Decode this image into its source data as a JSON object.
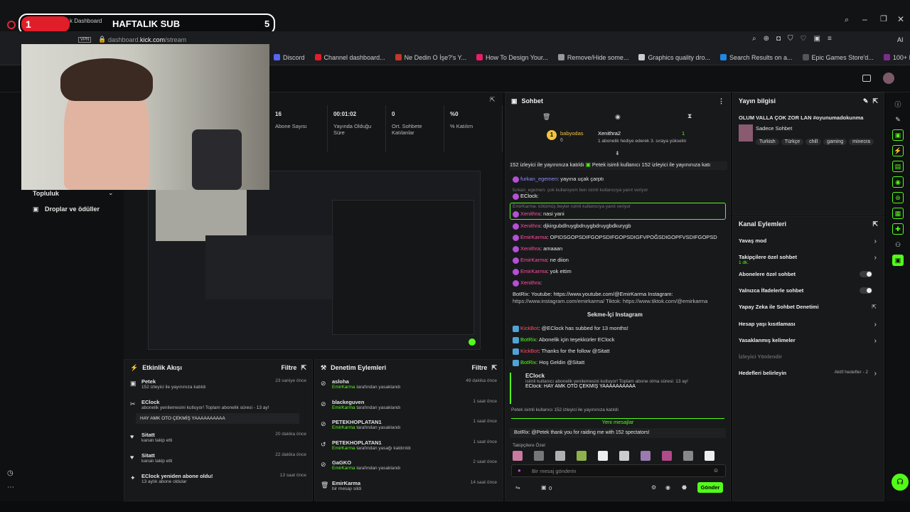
{
  "overlay": {
    "count_left": "1",
    "title": "HAFTALIK SUB",
    "count_right": "5",
    "tab_label": "k Dashboard"
  },
  "browser": {
    "url_prefix": "dashboard.",
    "url_domain": "kick.com",
    "url_path": "/stream",
    "vpn": "VPN",
    "ai": "AI",
    "bookmarks": [
      "Discord",
      "Channel dashboard...",
      "Ne Dedin O İşe?'s Y...",
      "How To Design Your...",
      "Remove/Hide some...",
      "Graphics quality dro...",
      "Search Results on a...",
      "Epic Games Store'd...",
      "100+ Free motion g..."
    ]
  },
  "stats": [
    {
      "value": "16",
      "label": "Abone Sayısı"
    },
    {
      "value": "00:01:02",
      "label": "Yayında Olduğu Süre"
    },
    {
      "value": "0",
      "label": "Ort. Sohbete Katılanlar"
    },
    {
      "value": "%0",
      "label": "% Katılım"
    }
  ],
  "leftnav": {
    "community": "Topluluk",
    "drops": "Droplar ve ödüller"
  },
  "activity": {
    "title": "Etkinlik Akışı",
    "filter": "Filtre",
    "items": [
      {
        "name": "Petek",
        "time": "23 saniye önce",
        "sub": "152 izleyici ile yayınınıza katıldı"
      },
      {
        "name": "EClock",
        "time": "",
        "sub": "abonelik yenilemesini kutluyor! Toplam abonelik süresi - 13 ay!",
        "quote": "HAY AMK OTO ÇEKMİŞ YAAAAAAAAAA"
      },
      {
        "name": "Sitatt",
        "time": "20 dakika önce",
        "sub": "kanalı takip etti"
      },
      {
        "name": "Sitatt",
        "time": "22 dakika önce",
        "sub": "kanalı takip etti"
      },
      {
        "name": "EClock yeniden abone oldu!",
        "time": "13 saat önce",
        "sub": "13 aylık abone oldular"
      }
    ]
  },
  "moderation": {
    "title": "Denetim Eylemleri",
    "filter": "Filtre",
    "items": [
      {
        "name": "asloha",
        "time": "49 dakika önce",
        "by": "EmirKarma",
        "action": "tarafından yasaklandı"
      },
      {
        "name": "blackeguven",
        "time": "1 saat önce",
        "by": "EmirKarma",
        "action": "tarafından yasaklandı"
      },
      {
        "name": "PETEKHOPLATAN1",
        "time": "1 saat önce",
        "by": "EmirKarma",
        "action": "tarafından yasaklandı"
      },
      {
        "name": "PETEKHOPLATAN1",
        "time": "1 saat önce",
        "by": "EmirKarma",
        "action": "tarafından yasağı kaldırıldı"
      },
      {
        "name": "GaGKO",
        "time": "2 saat önce",
        "by": "EmirKarma",
        "action": "tarafından yasaklandı"
      },
      {
        "name": "EmirKarma",
        "time": "14 saat önce",
        "by": "",
        "action": "bir mesajı sildi"
      }
    ]
  },
  "chat": {
    "title": "Sohbet",
    "gifter1": "babyodas",
    "gifter1_n": "6",
    "gifter2": "Xenithra2",
    "gifter2_n": "1",
    "gift_note": "1 abonelik hediye ederek 3. sıraya yükselin",
    "raid_banner": "152 izleyici ile yayınınıza katıldı",
    "raid_banner2": "Petek isimli kullanıcı 152 izleyici ile yayınınıza katı",
    "lines": [
      {
        "u": "furkan_egemen",
        "t": ": yayına uçak çarptı",
        "c": "#8c8cff"
      },
      {
        "u": "",
        "t": "furkan_egemen: çok kullanıyom ben isimli kullanıcıya yanıt veriyor",
        "c": "#777"
      },
      {
        "u": "EClock",
        "t": ":",
        "c": "#fff"
      },
      {
        "u": "",
        "t": "EmirKarma: kötümüş beyler isimli kullanıcıya yanıt veriyor",
        "c": "#777"
      },
      {
        "u": "Xenithra",
        "t": ": nasi yani",
        "c": "#ff4fa0"
      },
      {
        "u": "Xenithra",
        "t": ": djkirgubdlruygbdruygbdruygbdkurygb",
        "c": "#ff4fa0"
      },
      {
        "u": "EmirKarma",
        "t": ": OPIDSGOPSDIFGOPSDIFGOPSDIGFVPOĞSDIGOPFVSDIFGOPSD",
        "c": "#ff4fa0"
      },
      {
        "u": "Xenithra",
        "t": ": amaaan",
        "c": "#ff4fa0"
      },
      {
        "u": "EmirKarma",
        "t": ": ne diion",
        "c": "#ff4fa0"
      },
      {
        "u": "EmirKarma",
        "t": ": yok ettim",
        "c": "#ff4fa0"
      },
      {
        "u": "Xenithra",
        "t": ":",
        "c": "#ff4fa0"
      }
    ],
    "botrix1": "BotRix: Youtube: https://www.youtube.com/@EmirKarma Instagram:",
    "botrix1b": "https://www.instagram.com/emirkarma/ Tiktok: https://www.tiktok.com/@emirkarma",
    "instagram": "Sekme-İçi Instagram",
    "lines2": [
      {
        "u": "KickBot",
        "t": ": @EClock has subbed for 13 months!"
      },
      {
        "u": "BotRix",
        "t": ": Abonelik için teşekkürler EClock"
      },
      {
        "u": "KickBot",
        "t": ": Thanks for the follow @Sitatt"
      },
      {
        "u": "BotRix",
        "t": ": Hoş Geldin @Sitatt"
      }
    ],
    "resub_name": "EClock",
    "resub_text": "isimli kullanıcı abonelik yenilemesini kutluyor! Toplam abone olma süresi: 13 ay!",
    "resub_msg": "EClock: HAY AMK OTO ÇEKMİŞ YAAAAAAAAAA",
    "raid_line": "Petek isimli kullanıcı 152 izleyici ile yayınınıza katıldı",
    "new_messages": "Yeni mesajlar",
    "thanks": "BotRix: @Petek thank you for raiding me with 152 spectators!",
    "followers_only": "Takipçilere Özel",
    "input_placeholder": "Bir mesaj gönderin",
    "send": "Gönder",
    "count": "0"
  },
  "stream_info": {
    "title": "Yayın bilgisi",
    "stream_title": "OLUM VALLA ÇOK ZOR LAN #oyunumadokunma",
    "category": "Sadece Sohbet",
    "tags": [
      "Turkish",
      "Türkçe",
      "chill",
      "gaming",
      "minecra"
    ]
  },
  "channel_actions": {
    "title": "Kanal Eylemleri",
    "items": [
      {
        "label": "Yavaş mod",
        "type": "arrow"
      },
      {
        "label": "Takipçilere özel sohbet",
        "sub": "1 dk.",
        "type": "arrow"
      },
      {
        "label": "Abonelere özel sohbet",
        "type": "toggle"
      },
      {
        "label": "Yalnızca İfadelerle sohbet",
        "type": "toggle"
      },
      {
        "label": "Yapay Zeka ile Sohbet Denetimi",
        "type": "ext"
      },
      {
        "label": "Hesap yaşı kısıtlaması",
        "type": "arrow"
      },
      {
        "label": "Yasaklanmış kelimeler",
        "type": "arrow"
      },
      {
        "label": "İzleyici Yönlendir",
        "type": "dim"
      },
      {
        "label": "Hedefleri belirleyin",
        "sub": "Aktif hedefler - 2",
        "type": "arrow"
      }
    ]
  },
  "colors": {
    "accent": "#53fc18",
    "bg": "#0b0c0d"
  }
}
